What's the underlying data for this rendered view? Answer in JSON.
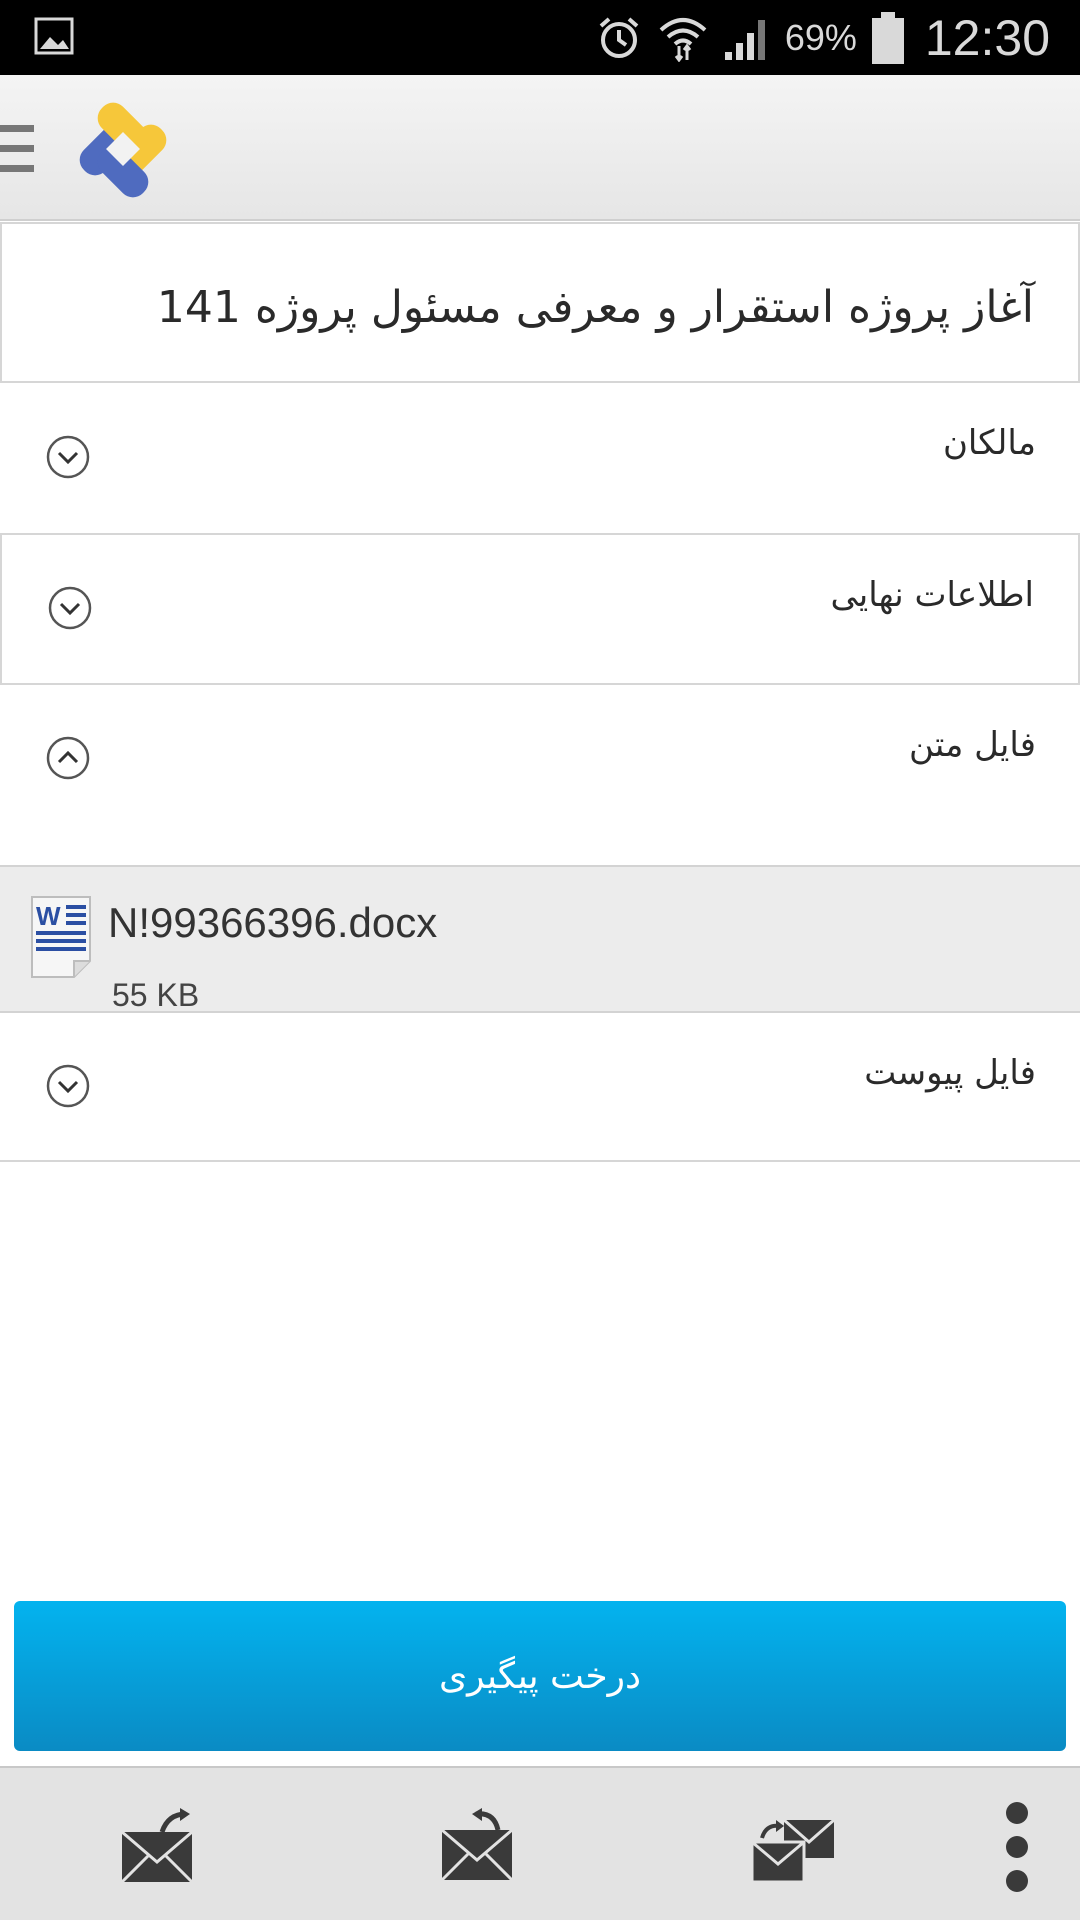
{
  "status_bar": {
    "battery_percent": "69%",
    "time": "12:30",
    "icons": [
      "gallery-icon",
      "alarm-icon",
      "wifi-icon",
      "signal-icon",
      "battery-icon"
    ]
  },
  "header": {
    "menu_icon": "menu-icon",
    "logo": "app-logo"
  },
  "document": {
    "title": "آغاز پروژه استقرار و معرفی مسئول پروژه 141"
  },
  "sections": [
    {
      "label": "مالکان",
      "state": "collapsed",
      "icon": "chevron-down-icon"
    },
    {
      "label": "اطلاعات نهایی",
      "state": "collapsed",
      "icon": "chevron-down-icon"
    },
    {
      "label": "فایل متن",
      "state": "expanded",
      "icon": "chevron-up-icon"
    },
    {
      "label": "فایل پیوست",
      "state": "collapsed",
      "icon": "chevron-down-icon"
    }
  ],
  "file": {
    "name": "N!99366396.docx",
    "size": "55 KB",
    "icon": "word-document-icon"
  },
  "tree_button": {
    "label": "درخت پیگیری"
  },
  "bottom_bar": {
    "items": [
      "forward-mail-icon",
      "reply-mail-icon",
      "reply-all-mail-icon",
      "overflow-menu-icon"
    ]
  },
  "colors": {
    "button_top": "#03b3ef",
    "button_bottom": "#0a8bc4",
    "logo_blue": "#4f6bbf",
    "logo_yellow": "#f6c73a"
  }
}
